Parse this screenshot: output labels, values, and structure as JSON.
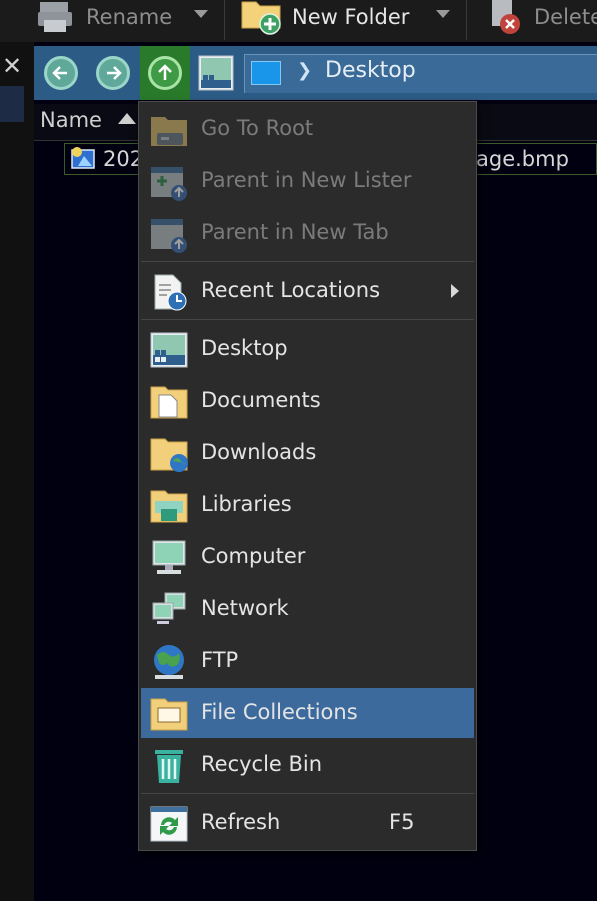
{
  "toolbar": {
    "rename_label": "Rename",
    "new_folder_label": "New Folder",
    "delete_label": "Delete"
  },
  "nav": {
    "path_segment": "Desktop"
  },
  "file_list": {
    "column_header": "Name",
    "visible_file_left": "202",
    "visible_file_right": "age.bmp"
  },
  "menu": {
    "items": [
      {
        "label": "Go To Root",
        "icon": "go-to-root-icon",
        "enabled": false
      },
      {
        "label": "Parent in New Lister",
        "icon": "parent-new-lister-icon",
        "enabled": false
      },
      {
        "label": "Parent in New Tab",
        "icon": "parent-new-tab-icon",
        "enabled": false
      },
      {
        "label": "Recent Locations",
        "icon": "recent-locations-icon",
        "enabled": true,
        "submenu": true
      },
      {
        "label": "Desktop",
        "icon": "desktop-icon",
        "enabled": true
      },
      {
        "label": "Documents",
        "icon": "documents-folder-icon",
        "enabled": true
      },
      {
        "label": "Downloads",
        "icon": "downloads-folder-icon",
        "enabled": true
      },
      {
        "label": "Libraries",
        "icon": "libraries-folder-icon",
        "enabled": true
      },
      {
        "label": "Computer",
        "icon": "computer-icon",
        "enabled": true
      },
      {
        "label": "Network",
        "icon": "network-icon",
        "enabled": true
      },
      {
        "label": "FTP",
        "icon": "ftp-globe-icon",
        "enabled": true
      },
      {
        "label": "File Collections",
        "icon": "file-collections-icon",
        "enabled": true,
        "highlighted": true
      },
      {
        "label": "Recycle Bin",
        "icon": "recycle-bin-icon",
        "enabled": true
      },
      {
        "label": "Refresh",
        "icon": "refresh-icon",
        "enabled": true,
        "shortcut": "F5"
      }
    ]
  },
  "colors": {
    "nav_bar": "#2c5b86",
    "menu_bg": "#2b2b2b",
    "menu_highlight": "#3c6a9c",
    "up_button": "#2a7a2c"
  }
}
